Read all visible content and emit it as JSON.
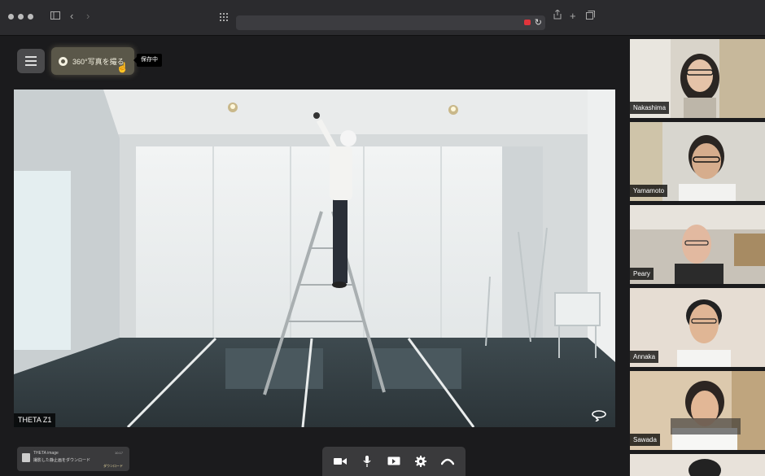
{
  "browser": {
    "nav_back": "‹",
    "nav_forward": "›"
  },
  "header": {
    "capture_label": "360°写真を撮る",
    "tooltip": "保存中"
  },
  "main_video": {
    "label": "THETA Z1"
  },
  "participants": [
    {
      "name": "Nakashima"
    },
    {
      "name": "Yamamoto"
    },
    {
      "name": "Peary"
    },
    {
      "name": "Annaka"
    },
    {
      "name": "Sawada"
    }
  ],
  "notification": {
    "app": "THETA image",
    "message": "撮影した静止画をダウンロード",
    "time": "10:17",
    "action": "ダウンロード"
  },
  "toolbar": {
    "items": [
      "camera-icon",
      "microphone-icon",
      "screen-share-icon",
      "settings-icon",
      "hang-up-icon"
    ]
  }
}
